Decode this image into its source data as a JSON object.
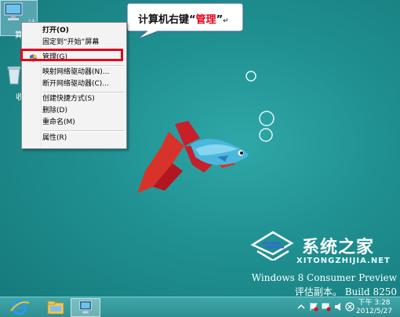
{
  "desktop": {
    "icons": [
      {
        "label": "计算",
        "name": "computer"
      },
      {
        "label": "回收",
        "name": "recycle-bin"
      }
    ]
  },
  "context_menu": {
    "items": [
      {
        "label": "打开(O)",
        "bold": true
      },
      {
        "label": "固定到“开始”屏幕"
      },
      {
        "label": "管理(G)",
        "highlighted": true
      },
      {
        "label": "映射网络驱动器(N)..."
      },
      {
        "label": "断开网络驱动器(C)..."
      },
      {
        "label": "创建快捷方式(S)"
      },
      {
        "label": "删除(D)"
      },
      {
        "label": "重命名(M)"
      },
      {
        "label": "属性(R)"
      }
    ]
  },
  "callout": {
    "prefix": "计算机右键“",
    "highlight": "管理",
    "suffix": "”",
    "return_mark": "↵"
  },
  "watermark": {
    "chinese": "系统之家",
    "english": "XITONGZHIJIA.NET"
  },
  "os_info": {
    "name": "Windows 8 Consumer Preview",
    "build": "评估副本。 Build 8250"
  },
  "clock": {
    "time": "下午 3:28",
    "date": "2012/5/27"
  },
  "colors": {
    "highlight_border": "#e5001b",
    "desktop_bg": "#1f8f90"
  }
}
